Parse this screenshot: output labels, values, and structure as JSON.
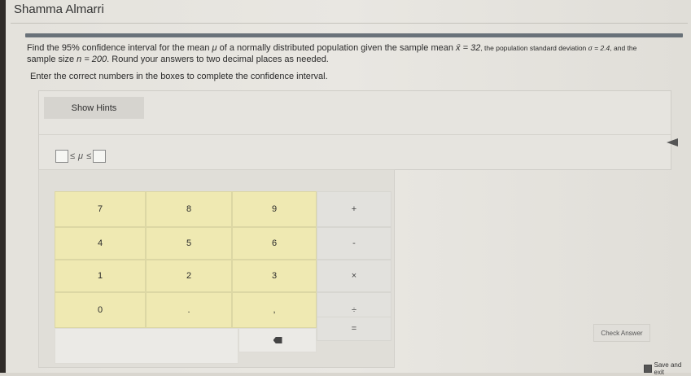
{
  "header": {
    "student_name": "Shamma Almarri"
  },
  "question": {
    "line1_a": "Find the ",
    "confidence": "95%",
    "line1_b": " confidence interval for the mean ",
    "mu": "μ",
    "line1_c": " of a normally distributed population given the sample mean ",
    "xbar_label": "x̄ = 32",
    "line1_d": ", the population standard deviation ",
    "sigma_label": "σ = 2.4",
    "line1_e": ", and the",
    "line2_a": "sample size ",
    "n_label": "n = 200",
    "line2_b": ". Round your answers to two decimal places as needed."
  },
  "instruction": "Enter the correct numbers in the boxes to complete the confidence interval.",
  "hints": {
    "button_label": "Show Hints"
  },
  "interval": {
    "le1": "≤",
    "mu": "μ",
    "le2": "≤"
  },
  "keypad": {
    "rows": [
      [
        "7",
        "8",
        "9"
      ],
      [
        "4",
        "5",
        "6"
      ],
      [
        "1",
        "2",
        "3"
      ],
      [
        "0",
        ".",
        ","
      ]
    ],
    "ops": [
      "+",
      "-",
      "×",
      "÷",
      "="
    ],
    "backspace_icon": "backspace-icon"
  },
  "actions": {
    "check_answer": "Check Answer",
    "save_exit": "Save and exit"
  }
}
